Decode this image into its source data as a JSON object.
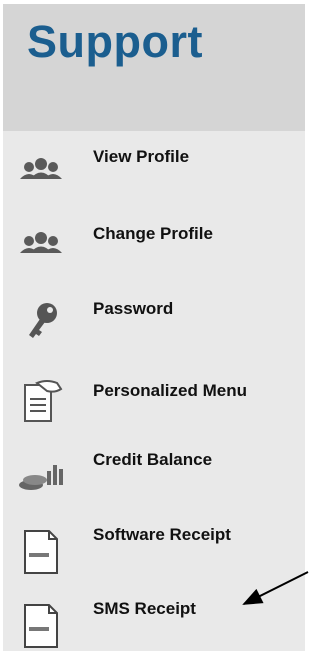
{
  "sidebar": {
    "title": "Support",
    "items": [
      {
        "label": "View Profile",
        "icon": "users-icon"
      },
      {
        "label": "Change Profile",
        "icon": "users-icon"
      },
      {
        "label": "Password",
        "icon": "key-icon"
      },
      {
        "label": "Personalized Menu",
        "icon": "document-hand-icon"
      },
      {
        "label": "Credit Balance",
        "icon": "coins-chart-icon"
      },
      {
        "label": "Software Receipt",
        "icon": "invoice-icon"
      },
      {
        "label": "SMS Receipt",
        "icon": "invoice-icon"
      }
    ]
  },
  "colors": {
    "title": "#1b5e8f",
    "panel_bg": "#e9e9e9",
    "header_bg": "#d5d5d5"
  }
}
